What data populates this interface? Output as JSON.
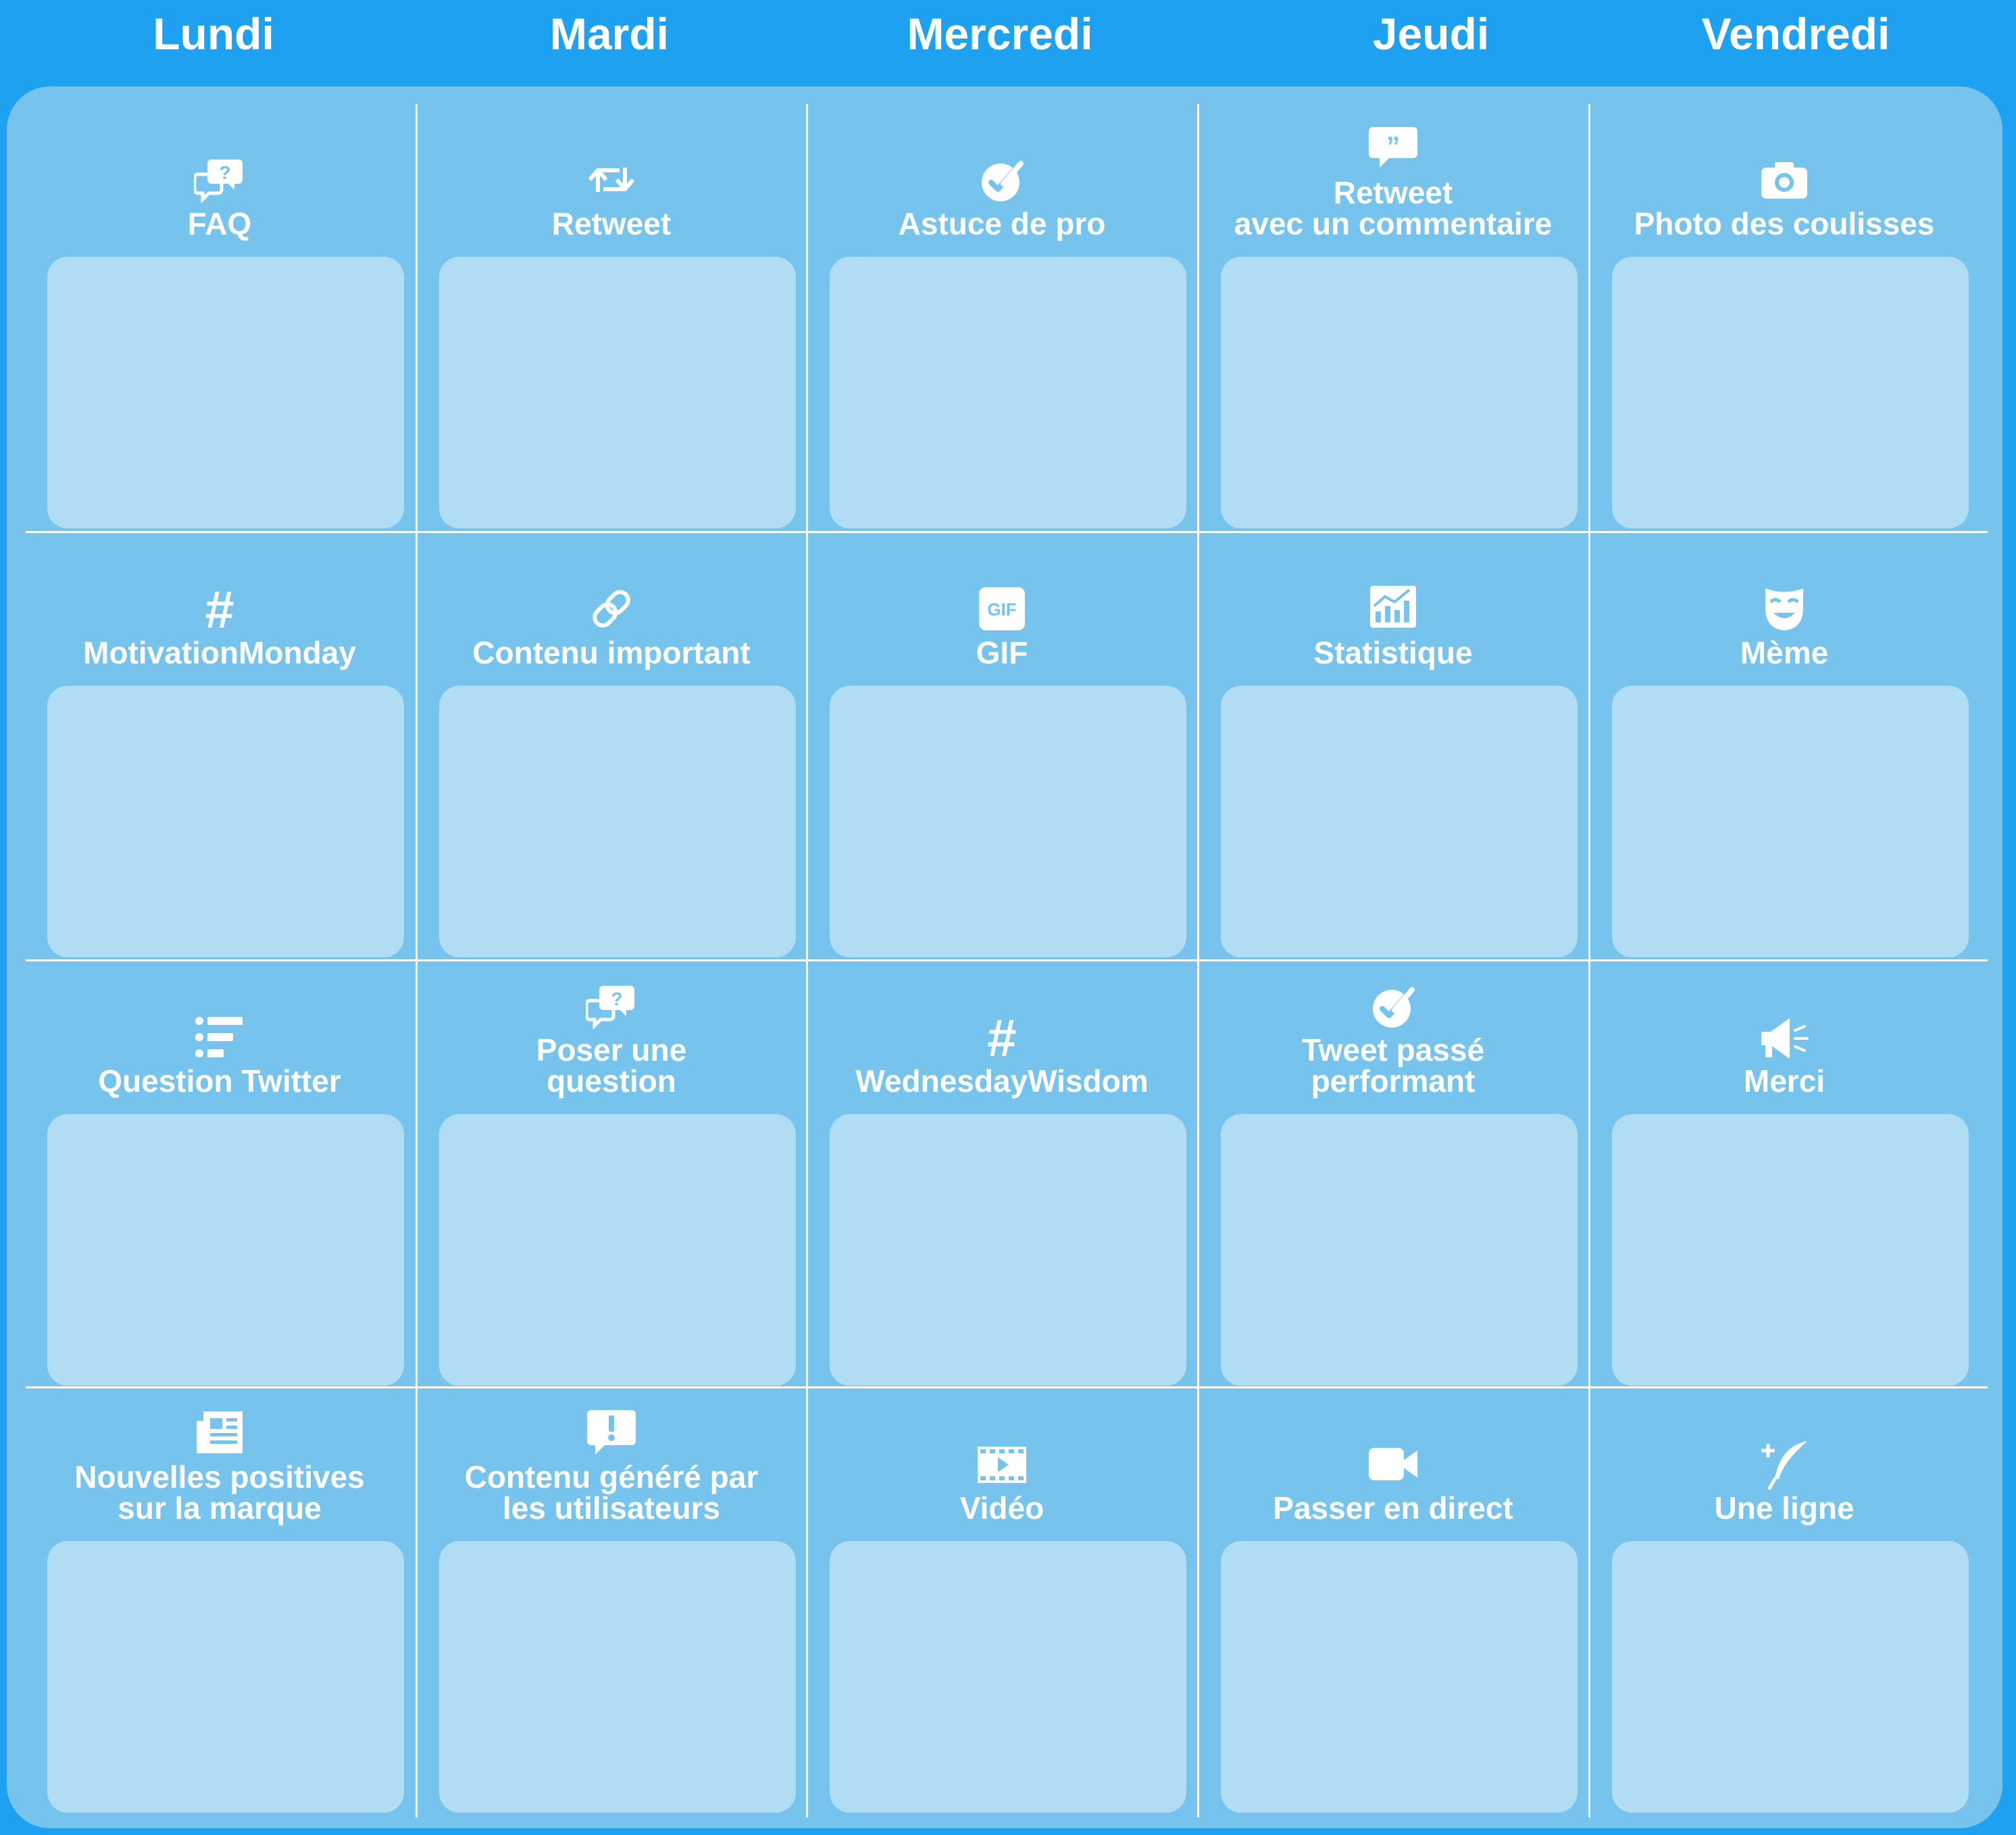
{
  "days": [
    "Lundi",
    "Mardi",
    "Mercredi",
    "Jeudi",
    "Vendredi"
  ],
  "rows": [
    [
      {
        "title": "FAQ",
        "icon": "question-chat-icon"
      },
      {
        "title": "Retweet",
        "icon": "retweet-icon"
      },
      {
        "title": "Astuce de pro",
        "icon": "check-badge-icon"
      },
      {
        "title": "Retweet\navec un commentaire",
        "icon": "quote-chat-icon"
      },
      {
        "title": "Photo des coulisses",
        "icon": "camera-icon"
      }
    ],
    [
      {
        "title": "MotivationMonday",
        "icon": "hashtag-icon"
      },
      {
        "title": "Contenu important",
        "icon": "link-icon"
      },
      {
        "title": "GIF",
        "icon": "gif-icon"
      },
      {
        "title": "Statistique",
        "icon": "chart-icon"
      },
      {
        "title": "Mème",
        "icon": "mask-icon"
      }
    ],
    [
      {
        "title": "Question Twitter",
        "icon": "poll-list-icon"
      },
      {
        "title": "Poser une\nquestion",
        "icon": "question-chat-icon"
      },
      {
        "title": "WednesdayWisdom",
        "icon": "hashtag-icon"
      },
      {
        "title": "Tweet passé\nperformant",
        "icon": "check-badge-icon"
      },
      {
        "title": "Merci",
        "icon": "megaphone-icon"
      }
    ],
    [
      {
        "title": "Nouvelles positives\nsur la marque",
        "icon": "newspaper-icon"
      },
      {
        "title": "Contenu généré par\nles utilisateurs",
        "icon": "alert-chat-icon"
      },
      {
        "title": "Vidéo",
        "icon": "film-icon"
      },
      {
        "title": "Passer en direct",
        "icon": "video-camera-icon"
      },
      {
        "title": "Une ligne",
        "icon": "quill-plus-icon"
      }
    ]
  ],
  "colors": {
    "header_bg": "#1fa1f1",
    "board_bg": "#76c4ed",
    "card_bg": "#b0ddf4",
    "text": "#ffffff"
  }
}
